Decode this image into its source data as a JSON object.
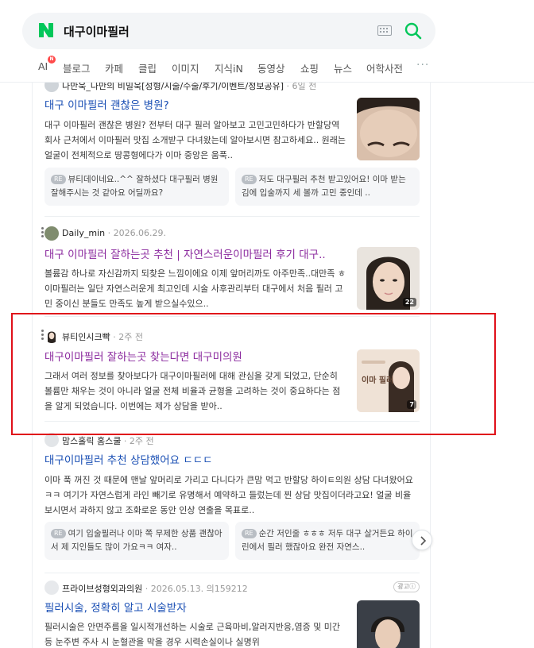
{
  "search": {
    "query": "대구이마필러"
  },
  "tabs": [
    "AI",
    "블로그",
    "카페",
    "클립",
    "이미지",
    "지식iN",
    "동영상",
    "쇼핑",
    "뉴스",
    "어학사전"
  ],
  "ai_badge": "N",
  "colors": {
    "accent": "#03c75a",
    "link_blue": "#1a4fb4",
    "visited_purple": "#8b2a9e",
    "highlight": "#e0101a"
  },
  "results": [
    {
      "source": "나만욱_나만의 비밀욱[성형/시술/수술/후기/이벤트/정보공유]",
      "date": " · 6일 전",
      "title": "대구 이마필러 괜찮은 병원?",
      "body": "대구 이마필러 괜찮은 병원? 전부터 대구 필러 알아보고 고민고민하다가 반할당역 회사 근처에서 이마필러 맛집 소개받구 다녀왔는데 알아보시면 참고하세요.. 원래는 얼굴이 전체적으로 땅콩형에다가 이마 중앙은 움푹..",
      "replies": [
        {
          "tag": "RE",
          "text": "뷰티데이네요..^^ 잘하셨다 대구필러 병원 잘해주시는 것 같아요 어딜까요?"
        },
        {
          "tag": "RE",
          "text": "저도 대구필러 추천 받고있어요! 이마 받는 김에 입술까지 세 볼까 고민 중인데 .."
        }
      ]
    },
    {
      "source": "Daily_min",
      "date": " · 2026.06.29.",
      "title": "대구 이마필러 잘하는곳 추천 | 자연스러운이마필러 후기 대구..",
      "body": "볼륨감 하나로 자신감까지 되찾은 느낌이에요 이제 앞머리까도 아주만족..대만족 ㅎ 이마필러는 일단 자연스러운게 최고인데 시술 사후관리부터 대구에서 처음 필러 고민 중이신 분들도 만족도 높게 받으실수있으..",
      "thumb_count": "22"
    },
    {
      "source": "뷰티인시크빡",
      "date": " · 2주 전",
      "title": "대구이마필러 잘하는곳 찾는다면 대구미의원",
      "body": "그래서 여러 정보를 찾아보다가 대구이마필러에 대해 관심을 갖게 되었고, 단순히 볼륨만 채우는 것이 아니라 얼굴 전체 비율과 균형을 고려하는 것이 중요하다는 점을 알게 되었습니다. 이번에는 제가 상담을 받아..",
      "thumb_count": "7",
      "thumb_text": "이마 필러"
    },
    {
      "source": "맘스홀릭 홈스쿨",
      "date": " · 2주 전",
      "title": "대구이마필러 추천 상담했어요 ㄷㄷㄷ",
      "body": "이마 푹 꺼진 것 때문에 맨날 앞머리로 가리고 다니다가 큰맘 먹고 반할당 하이ㅌ의원 상담 다녀왔어요ㅋㅋ 여기가 자연스럽게 라인 빼기로 유명해서 예약하고 들렀는데 찐 상담 맛집이더라고요! 얼굴 비율 보시면서 과하지 않고 조화로운 동안 인상 연출을 목표로..",
      "replies": [
        {
          "tag": "RE",
          "text": "여기 입술필러나 이마 쪽 무제한 상품 괜찮아서 제 지인들도 많이 가요ㅋㅋ 여자.."
        },
        {
          "tag": "RE",
          "text": "순간 저인줄 ㅎㅎㅎ 저두 대구 살거든요 하이린에서 필러 했잖아요 완전 자연스.."
        }
      ]
    },
    {
      "source": "프라이브성형외과의원",
      "date": " · 2026.05.13. 의159212",
      "ad": "광고ⓘ",
      "title": "필러시술, 정확히 알고 시술받자",
      "body": "필러시술은 안면주름을 일시적개선하는 시술로 근육마비,알러지반응,염증 및 미간 등 눈주변 주사 시 눈혈관을 막을 경우 시력손실이나 실명위"
    }
  ]
}
